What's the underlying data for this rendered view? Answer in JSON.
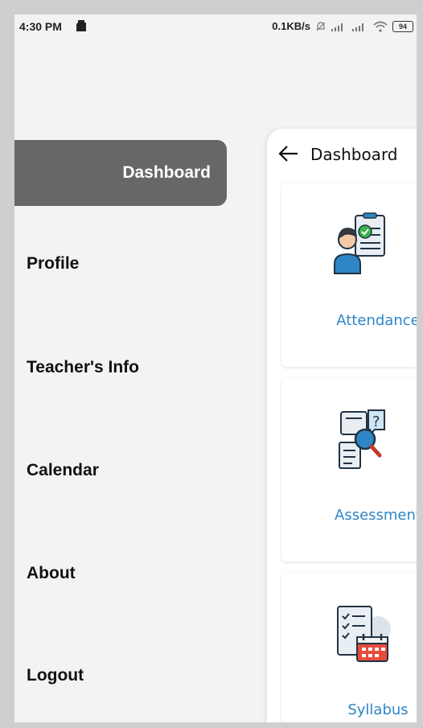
{
  "status_bar": {
    "time": "4:30 PM",
    "network_speed": "0.1KB/s",
    "battery": "94"
  },
  "drawer": {
    "active_item": "Dashboard",
    "items": [
      {
        "label": "Profile"
      },
      {
        "label": "Teacher's Info"
      },
      {
        "label": "Calendar"
      },
      {
        "label": "About"
      },
      {
        "label": "Logout"
      }
    ]
  },
  "dashboard": {
    "title": "Dashboard",
    "cards": [
      {
        "label": "Attendance",
        "icon": "attendance-icon"
      },
      {
        "label": "Assessment",
        "icon": "assessment-icon"
      },
      {
        "label": "Syllabus",
        "icon": "syllabus-icon"
      }
    ]
  },
  "colors": {
    "active_item_bg": "#676767",
    "card_label": "#2f86c6",
    "background": "#f3f3f3"
  }
}
